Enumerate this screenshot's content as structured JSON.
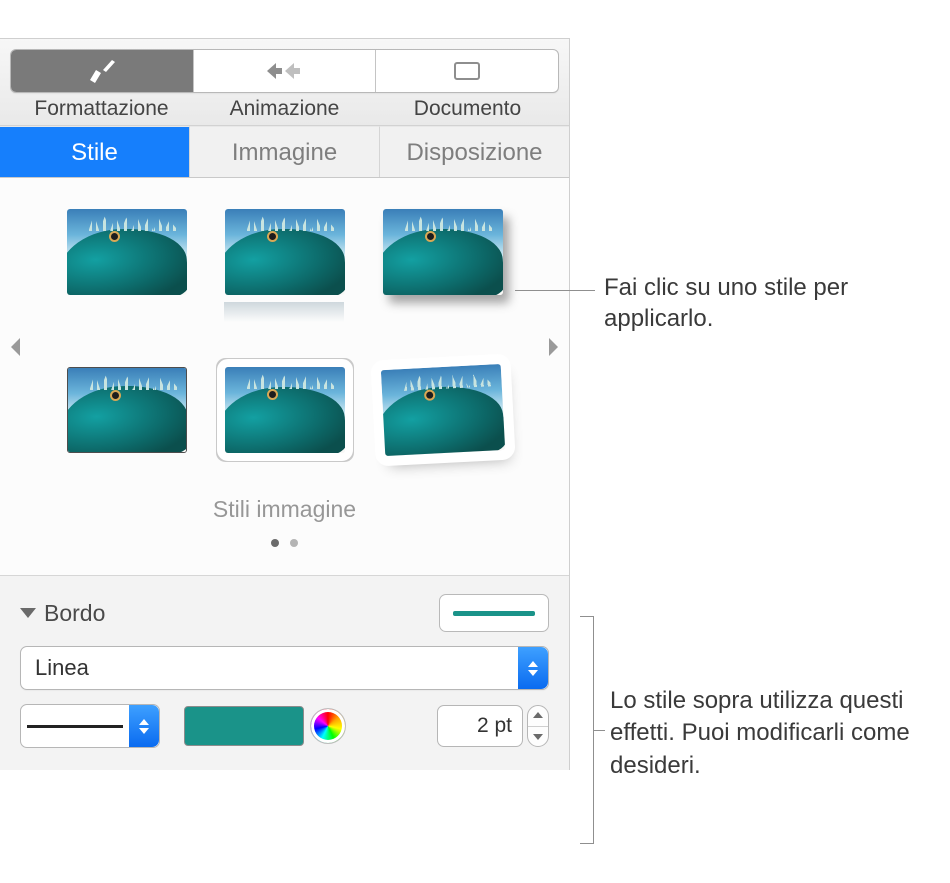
{
  "segmented": {
    "items": [
      {
        "label": "Formattazione",
        "icon": "brush"
      },
      {
        "label": "Animazione",
        "icon": "animation"
      },
      {
        "label": "Documento",
        "icon": "document"
      }
    ],
    "active_index": 0
  },
  "tabs": {
    "items": [
      {
        "label": "Stile"
      },
      {
        "label": "Immagine"
      },
      {
        "label": "Disposizione"
      }
    ],
    "active_index": 0
  },
  "styles_caption": "Stili immagine",
  "border": {
    "title": "Bordo",
    "type_label": "Linea",
    "width_value": "2 pt",
    "color_hex": "#1a9389"
  },
  "callouts": {
    "top": "Fai clic su uno stile per applicarlo.",
    "bottom": "Lo stile sopra utilizza questi effetti. Puoi modificarli come desideri."
  }
}
